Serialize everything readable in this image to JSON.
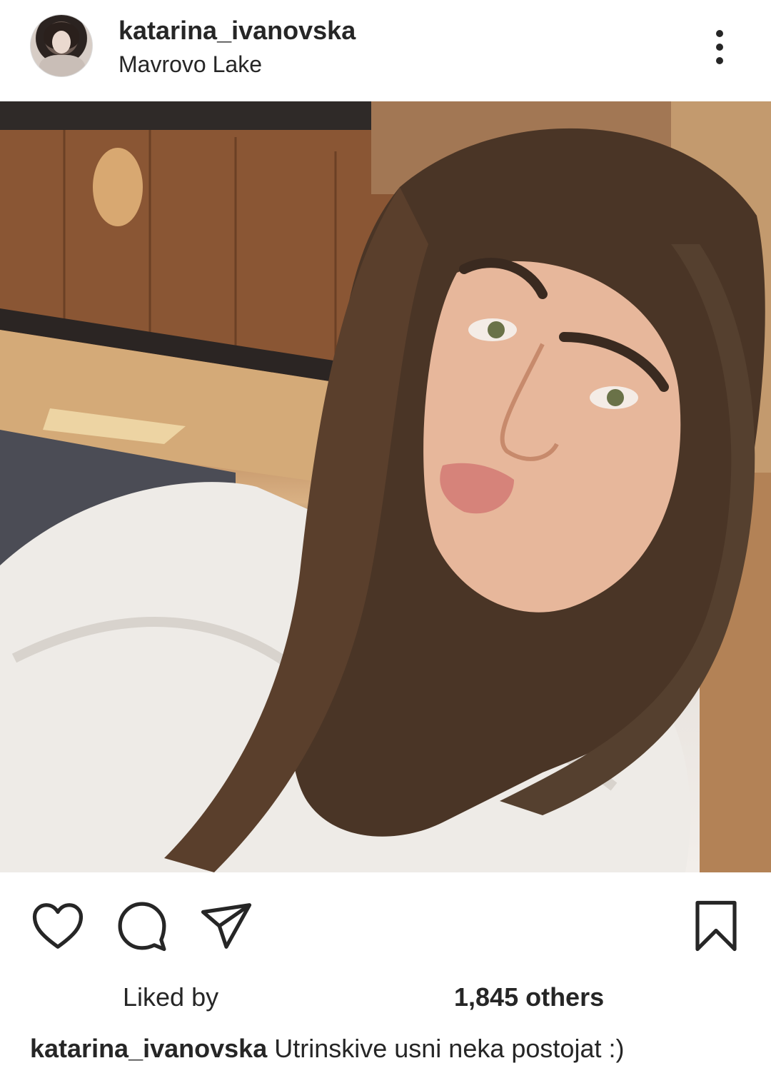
{
  "header": {
    "username": "katarina_ivanovska",
    "location": "Mavrovo Lake",
    "avatar_icon": "profile-avatar",
    "more_icon": "more-options-vertical-icon"
  },
  "post": {
    "image_icon": "selfie-photo",
    "actions": {
      "like_icon": "heart-icon",
      "comment_icon": "comment-bubble-icon",
      "share_icon": "paper-plane-icon",
      "save_icon": "bookmark-icon"
    },
    "likes": {
      "liked_by_text": "Liked by",
      "others_text": "1,845 others"
    },
    "caption": {
      "username": "katarina_ivanovska",
      "text": "Utrinskive usni neka postojat :)"
    }
  },
  "colors": {
    "text": "#262626",
    "background": "#ffffff"
  }
}
